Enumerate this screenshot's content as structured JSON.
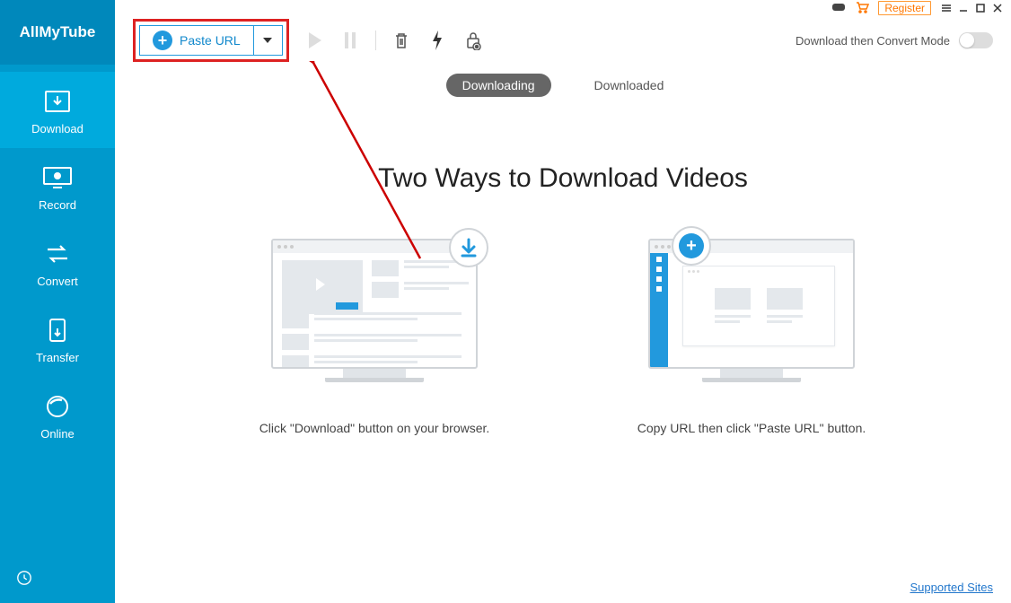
{
  "app_name": "AllMyTube",
  "titlebar": {
    "register": "Register"
  },
  "sidebar": {
    "items": [
      {
        "label": "Download"
      },
      {
        "label": "Record"
      },
      {
        "label": "Convert"
      },
      {
        "label": "Transfer"
      },
      {
        "label": "Online"
      }
    ]
  },
  "toolbar": {
    "paste_url": "Paste URL",
    "convert_mode": "Download then Convert Mode"
  },
  "subtabs": {
    "downloading": "Downloading",
    "downloaded": "Downloaded"
  },
  "content": {
    "headline": "Two Ways to Download Videos",
    "way1_caption": "Click \"Download\" button on your browser.",
    "way2_caption": "Copy URL then click \"Paste URL\" button."
  },
  "footer": {
    "supported_sites": "Supported Sites"
  }
}
